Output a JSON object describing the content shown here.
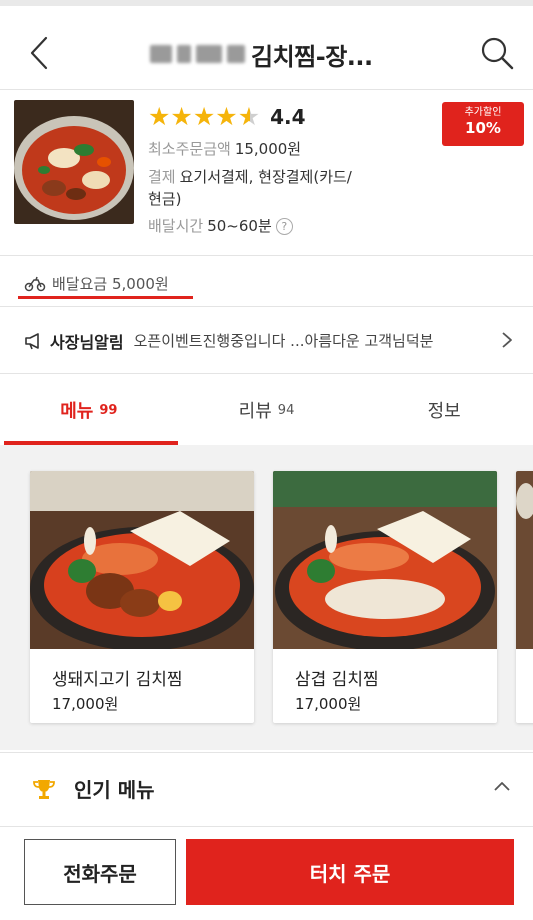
{
  "header": {
    "title": "김치찜-장...",
    "back_icon": "back-arrow-icon",
    "search_icon": "search-icon"
  },
  "store": {
    "rating": "4.4",
    "stars": 4.5,
    "min_order_label": "최소주문금액",
    "min_order_value": "15,000원",
    "payment_label": "결제",
    "payment_value_line1": "요기서결제, 현장결제(카드/",
    "payment_value_line2": "현금)",
    "delivery_time_label": "배달시간",
    "delivery_time_value": "50~60분",
    "help_icon_text": "?",
    "discount_small": "추가할인",
    "discount_big": "10%"
  },
  "delivery_fee": {
    "text": "배달요금 5,000원",
    "icon": "scooter-icon"
  },
  "notice": {
    "title": "사장님알림",
    "message": "오픈이벤트진행중입니다 ...아름다운 고객님덕분",
    "icon": "megaphone-icon"
  },
  "tabs": [
    {
      "label": "메뉴",
      "count": "99",
      "active": true
    },
    {
      "label": "리뷰",
      "count": "94",
      "active": false
    },
    {
      "label": "정보",
      "count": "",
      "active": false
    }
  ],
  "menu_cards": [
    {
      "name": "생돼지고기 김치찜",
      "price": "17,000원"
    },
    {
      "name": "삼겹 김치찜",
      "price": "17,000원"
    }
  ],
  "popular": {
    "label": "인기 메뉴",
    "icon": "trophy-icon"
  },
  "bottom": {
    "phone_order": "전화주문",
    "touch_order": "터치 주문"
  },
  "colors": {
    "accent": "#e0231d",
    "star": "#f5b40b",
    "background": "#f2f2f2"
  }
}
